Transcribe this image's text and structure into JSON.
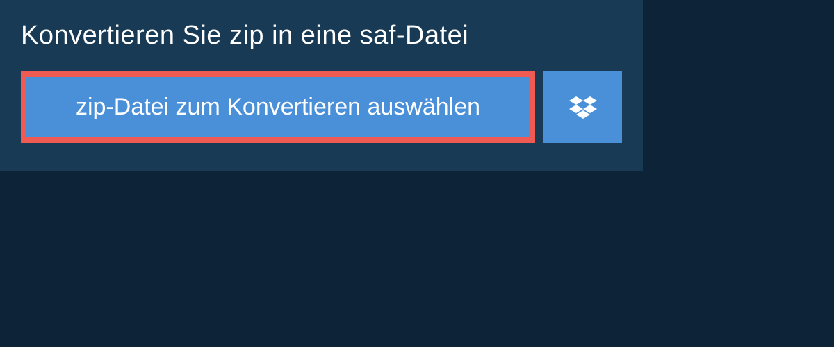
{
  "title": "Konvertieren Sie zip in eine saf-Datei",
  "buttons": {
    "select_file_label": "zip-Datei zum Konvertieren auswählen"
  },
  "colors": {
    "background_dark": "#0d2438",
    "panel": "#183a54",
    "button_primary": "#4a90d9",
    "button_border_highlight": "#ef5a52",
    "text": "#ffffff"
  }
}
